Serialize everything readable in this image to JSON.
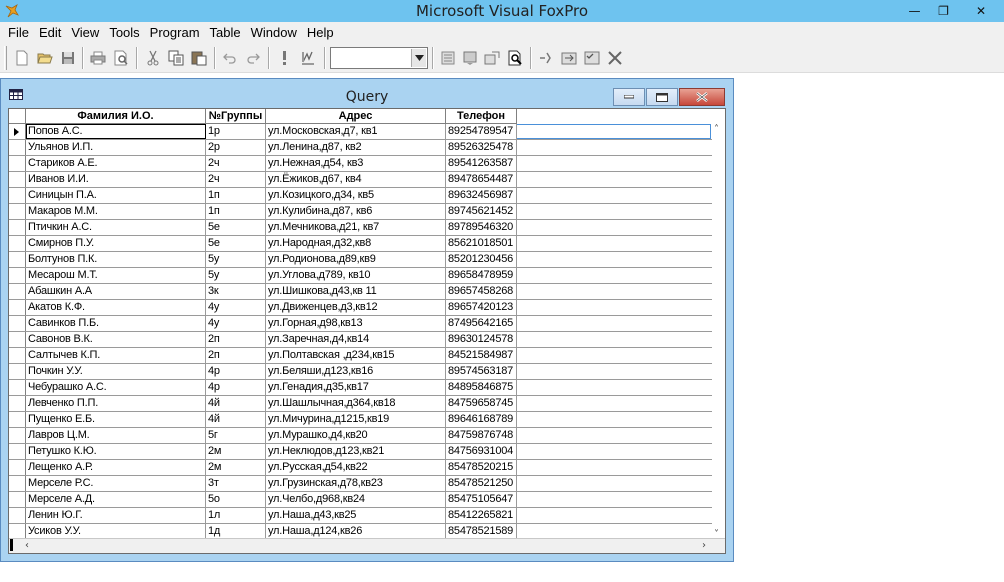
{
  "app": {
    "title": "Microsoft Visual FoxPro",
    "window_controls": {
      "minimize": "—",
      "restore": "❐",
      "close": "✕"
    }
  },
  "menu": [
    "File",
    "Edit",
    "View",
    "Tools",
    "Program",
    "Table",
    "Window",
    "Help"
  ],
  "toolbar": {
    "icons": [
      "new-icon",
      "open-icon",
      "save-icon",
      "print-icon",
      "print-preview-icon",
      "cut-icon",
      "copy-icon",
      "paste-icon",
      "undo-icon",
      "redo-icon",
      "run-icon",
      "modify-form-icon",
      "database-icon",
      "command-window-icon",
      "data-session-icon",
      "report-designer-icon",
      "connect-icon",
      "class-browser-icon",
      "component-gallery-icon",
      "toolbox-icon"
    ],
    "combo_value": ""
  },
  "query": {
    "title": "Query",
    "columns": [
      "Фамилия И.О.",
      "№Группы",
      "Адрес",
      "Телефон"
    ],
    "rows": [
      [
        "Попов А.С.",
        "1р",
        "ул.Московская,д7, кв1",
        "89254789547"
      ],
      [
        "Ульянов И.П.",
        "2р",
        "ул.Ленина,д87, кв2",
        "89526325478"
      ],
      [
        "Стариков А.Е.",
        "2ч",
        "ул.Нежная,д54, кв3",
        "89541263587"
      ],
      [
        "Иванов И.И.",
        "2ч",
        "ул.Ёжиков,д67, кв4",
        "89478654487"
      ],
      [
        "Синицын П.А.",
        "1п",
        "ул.Козицкого,д34, кв5",
        "89632456987"
      ],
      [
        "Макаров М.М.",
        "1п",
        "ул.Кулибина,д87, кв6",
        "89745621452"
      ],
      [
        "Птичкин А.С.",
        "5е",
        "ул.Мечникова,д21, кв7",
        "89789546320"
      ],
      [
        "Смирнов П.У.",
        "5е",
        "ул.Народная,д32,кв8",
        "85621018501"
      ],
      [
        "Болтунов П.К.",
        "5у",
        "ул.Родионова,д89,кв9",
        "85201230456"
      ],
      [
        "Месарош М.Т.",
        "5у",
        "ул.Углова,д789, кв10",
        "89658478959"
      ],
      [
        "Абашкин А.А",
        "3к",
        "ул.Шишкова,д43,кв 11",
        "89657458268"
      ],
      [
        "Акатов К.Ф.",
        "4у",
        "ул.Движенцев,д3,кв12",
        "89657420123"
      ],
      [
        "Савинков П.Б.",
        "4у",
        "ул.Горная,д98,кв13",
        "87495642165"
      ],
      [
        "Савонов В.К.",
        "2п",
        "ул.Заречная,д4,кв14",
        "89630124578"
      ],
      [
        "Салтычев К.П.",
        "2п",
        "ул.Полтавская ,д234,кв15",
        "84521584987"
      ],
      [
        "Почкин У.У.",
        "4р",
        "ул.Беляши,д123,кв16",
        "89574563187"
      ],
      [
        "Чебурашко А.С.",
        "4р",
        "ул.Генадия,д35,кв17",
        "84895846875"
      ],
      [
        "Левченко П.П.",
        "4й",
        "ул.Шашлычная,д364,кв18",
        "84759658745"
      ],
      [
        "Пущенко Е.Б.",
        "4й",
        "ул.Мичурина,д1215,кв19",
        "89646168789"
      ],
      [
        "Лавров Ц.М.",
        "5г",
        "ул.Мурашко,д4,кв20",
        "84759876748"
      ],
      [
        "Петушко К.Ю.",
        "2м",
        "ул.Неклюдов,д123,кв21",
        "84756931004"
      ],
      [
        "Лещенко А.Р.",
        "2м",
        "ул.Русская,д54,кв22",
        "85478520215"
      ],
      [
        "Мерселе Р.С.",
        "3т",
        "ул.Грузинская,д78,кв23",
        "85478521250"
      ],
      [
        "Мерселе А.Д.",
        "5о",
        "ул.Челбо,д968,кв24",
        "85475105647"
      ],
      [
        "Ленин Ю.Г.",
        "1л",
        "ул.Наша,д43,кв25",
        "85412265821"
      ],
      [
        "Усиков У.У.",
        "1д",
        "ул.Наша,д124,кв26",
        "85478521589"
      ]
    ]
  }
}
